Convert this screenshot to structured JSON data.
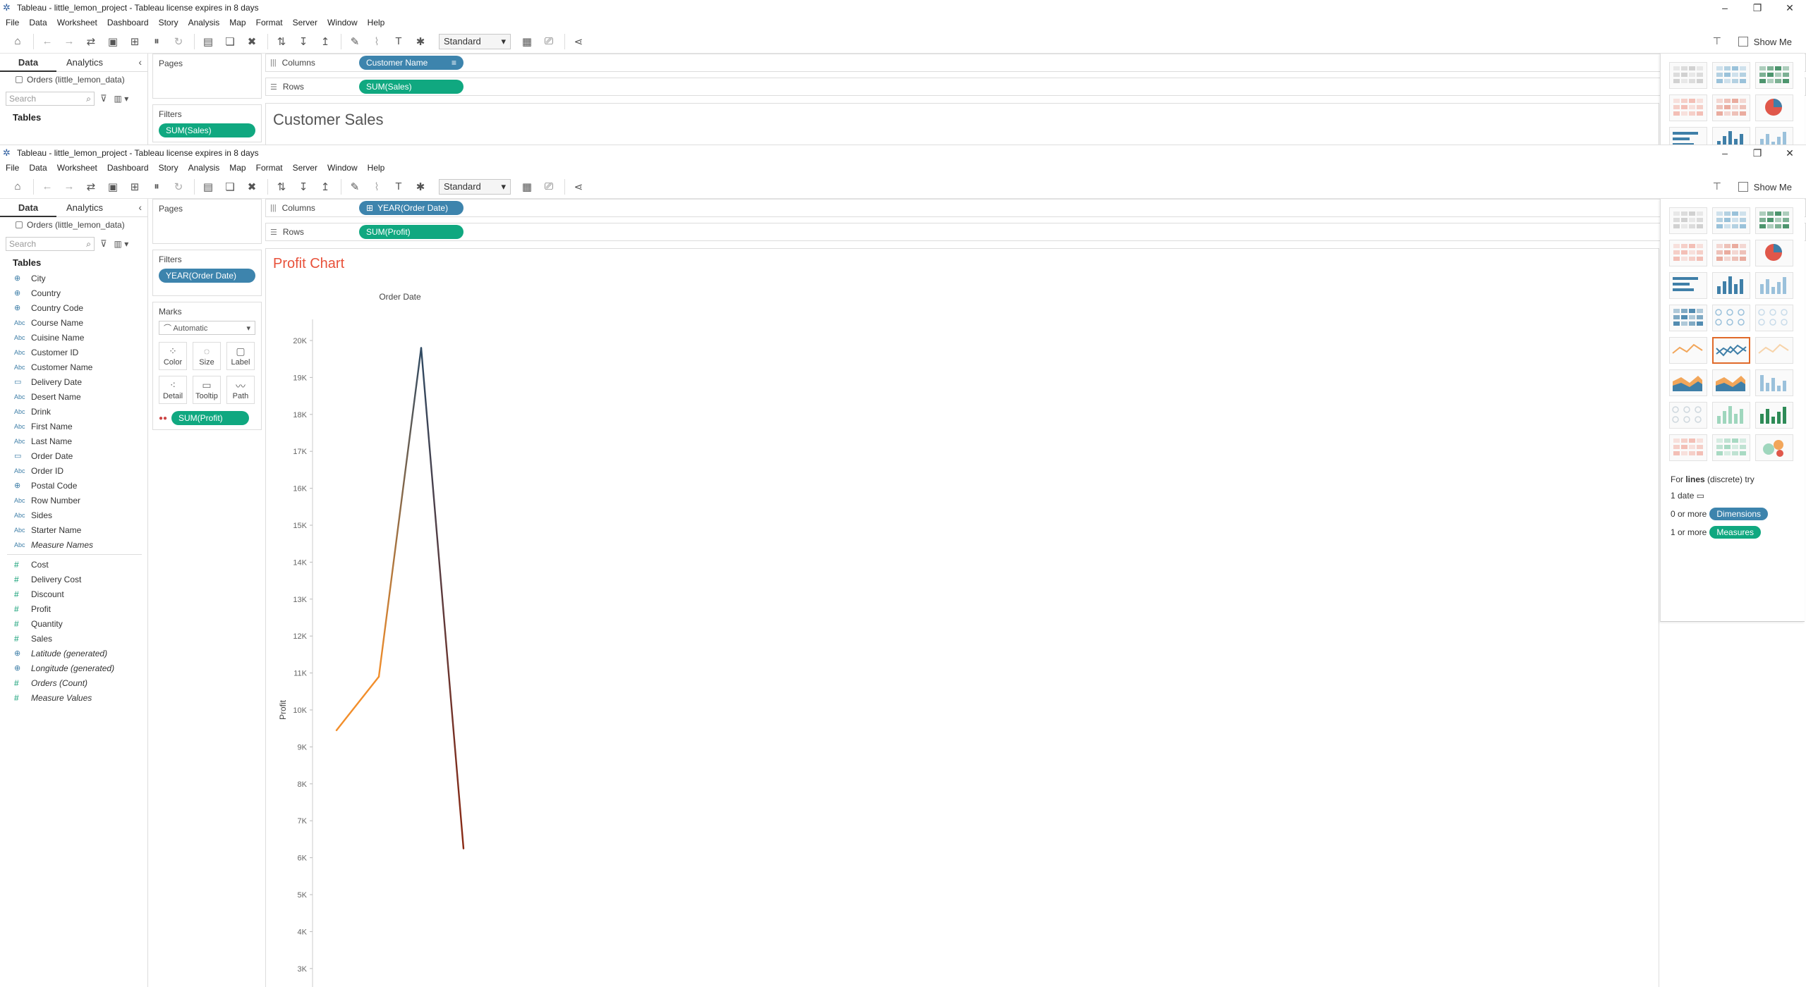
{
  "back_window": {
    "title": "Tableau - little_lemon_project - Tableau license expires in 8 days",
    "menu": [
      "File",
      "Data",
      "Worksheet",
      "Dashboard",
      "Story",
      "Analysis",
      "Map",
      "Format",
      "Server",
      "Window",
      "Help"
    ],
    "toolbar": {
      "fit_select": "Standard",
      "show_me": "Show Me"
    },
    "data_tabs": {
      "data": "Data",
      "analytics": "Analytics"
    },
    "source": "Orders (little_lemon_data)",
    "search_placeholder": "Search",
    "tables_label": "Tables",
    "pages_label": "Pages",
    "filters_label": "Filters",
    "filter_pill": "SUM(Sales)",
    "columns_label": "Columns",
    "rows_label": "Rows",
    "columns_pill": "Customer Name",
    "rows_pill": "SUM(Sales)",
    "sheet_title": "Customer Sales"
  },
  "front_window": {
    "title": "Tableau - little_lemon_project - Tableau license expires in 8 days",
    "menu": [
      "File",
      "Data",
      "Worksheet",
      "Dashboard",
      "Story",
      "Analysis",
      "Map",
      "Format",
      "Server",
      "Window",
      "Help"
    ],
    "toolbar": {
      "fit_select": "Standard",
      "show_me": "Show Me"
    },
    "data_tabs": {
      "data": "Data",
      "analytics": "Analytics"
    },
    "source": "Orders (little_lemon_data)",
    "search_placeholder": "Search",
    "tables_label": "Tables",
    "dimensions": [
      {
        "icon": "globe",
        "name": "City"
      },
      {
        "icon": "globe",
        "name": "Country"
      },
      {
        "icon": "globe",
        "name": "Country Code"
      },
      {
        "icon": "Abc",
        "name": "Course Name"
      },
      {
        "icon": "Abc",
        "name": "Cuisine Name"
      },
      {
        "icon": "Abc",
        "name": "Customer ID"
      },
      {
        "icon": "Abc",
        "name": "Customer Name"
      },
      {
        "icon": "date",
        "name": "Delivery Date"
      },
      {
        "icon": "Abc",
        "name": "Desert Name"
      },
      {
        "icon": "Abc",
        "name": "Drink"
      },
      {
        "icon": "Abc",
        "name": "First Name"
      },
      {
        "icon": "Abc",
        "name": "Last Name"
      },
      {
        "icon": "date",
        "name": "Order Date"
      },
      {
        "icon": "Abc",
        "name": "Order ID"
      },
      {
        "icon": "globe",
        "name": "Postal Code"
      },
      {
        "icon": "Abc",
        "name": "Row Number"
      },
      {
        "icon": "Abc",
        "name": "Sides"
      },
      {
        "icon": "Abc",
        "name": "Starter Name"
      },
      {
        "icon": "Abc",
        "name": "Measure Names",
        "italic": true
      }
    ],
    "measures": [
      {
        "icon": "#",
        "name": "Cost"
      },
      {
        "icon": "#",
        "name": "Delivery Cost"
      },
      {
        "icon": "#",
        "name": "Discount"
      },
      {
        "icon": "#",
        "name": "Profit"
      },
      {
        "icon": "#",
        "name": "Quantity"
      },
      {
        "icon": "#",
        "name": "Sales"
      },
      {
        "icon": "globe",
        "name": "Latitude (generated)",
        "italic": true
      },
      {
        "icon": "globe",
        "name": "Longitude (generated)",
        "italic": true
      },
      {
        "icon": "#",
        "name": "Orders (Count)",
        "italic": true
      },
      {
        "icon": "#",
        "name": "Measure Values",
        "italic": true
      }
    ],
    "pages_label": "Pages",
    "filters_label": "Filters",
    "filter_pill": "YEAR(Order Date)",
    "marks_label": "Marks",
    "marks_type": "Automatic",
    "mark_buttons": [
      {
        "icon": "color-dots",
        "label": "Color"
      },
      {
        "icon": "size",
        "label": "Size"
      },
      {
        "icon": "label",
        "label": "Label"
      },
      {
        "icon": "detail",
        "label": "Detail"
      },
      {
        "icon": "tooltip",
        "label": "Tooltip"
      },
      {
        "icon": "path",
        "label": "Path"
      }
    ],
    "marks_pill": "SUM(Profit)",
    "columns_label": "Columns",
    "rows_label": "Rows",
    "columns_pill": "YEAR(Order Date)",
    "rows_pill": "SUM(Profit)",
    "sheet_title": "Profit Chart",
    "show_me_hint": {
      "prefix": "For",
      "bold": "lines",
      "suffix": "(discrete) try",
      "line1": "1 date",
      "line2_prefix": "0 or more",
      "line2_pill": "Dimensions",
      "line3_prefix": "1 or more",
      "line3_pill": "Measures"
    }
  },
  "chart_data": {
    "type": "line",
    "title": "Profit Chart",
    "xlabel": "Order Date",
    "ylabel": "Profit",
    "yticks": [
      "20K",
      "19K",
      "18K",
      "17K",
      "16K",
      "15K",
      "14K",
      "13K",
      "12K",
      "11K",
      "10K",
      "9K",
      "8K",
      "7K",
      "6K",
      "5K",
      "4K",
      "3K"
    ],
    "ylim": [
      3000,
      20000
    ],
    "values": [
      9450,
      10900,
      19800,
      6250
    ],
    "color_scale": {
      "low": "#8b2a14",
      "mid": "#2f4a63",
      "high": "#f28e2b"
    },
    "grid": false
  }
}
